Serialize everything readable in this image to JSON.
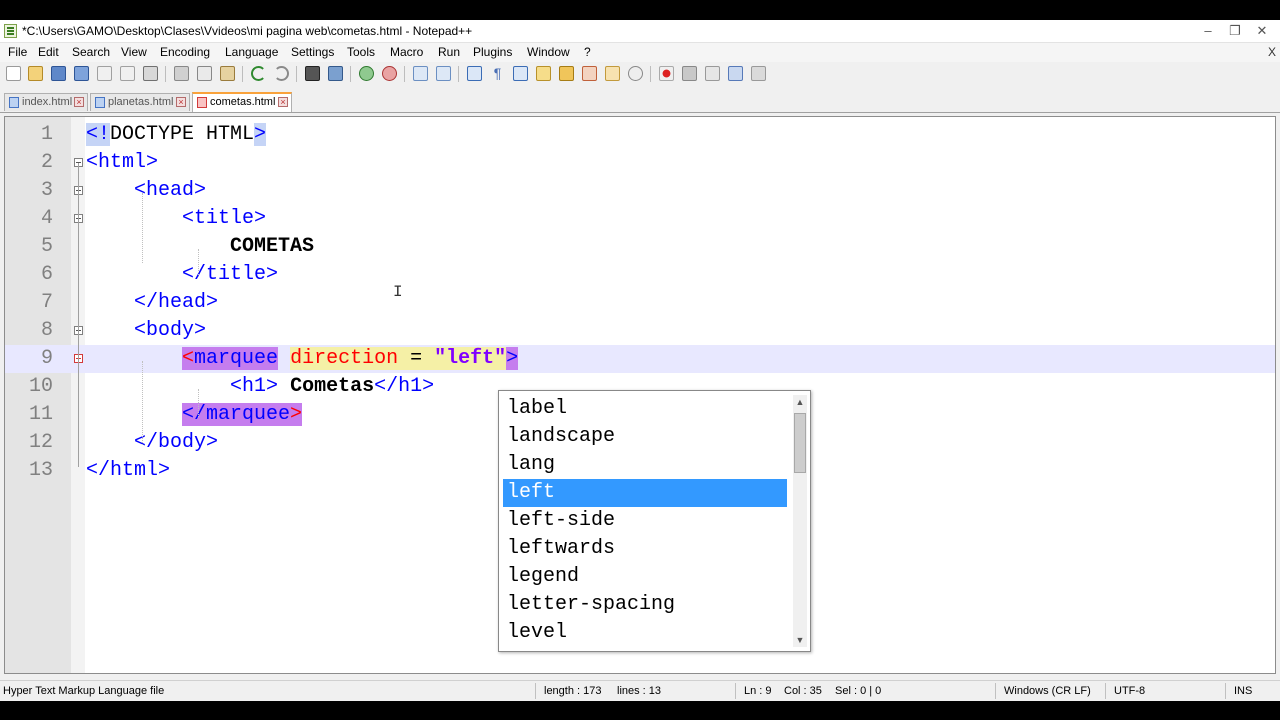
{
  "window": {
    "title": "*C:\\Users\\GAMO\\Desktop\\Clases\\Vvideos\\mi pagina web\\cometas.html - Notepad++",
    "controls": {
      "minimize": "–",
      "restore": "❐",
      "close": "✕"
    }
  },
  "menu": {
    "items": [
      "File",
      "Edit",
      "Search",
      "View",
      "Encoding",
      "Language",
      "Settings",
      "Tools",
      "Macro",
      "Run",
      "Plugins",
      "Window",
      "?"
    ],
    "close": "X"
  },
  "tabs": [
    {
      "label": "index.html",
      "active": false
    },
    {
      "label": "planetas.html",
      "active": false
    },
    {
      "label": "cometas.html",
      "active": true
    }
  ],
  "editor": {
    "current_line": 9,
    "lines": [
      {
        "num": "1",
        "frags": [
          [
            "<!",
            "hl-doc tag"
          ],
          [
            "DOCTYPE HTML",
            ""
          ],
          [
            ">",
            "hl-doc tag"
          ]
        ]
      },
      {
        "num": "2",
        "frags": [
          [
            "<html>",
            "tag"
          ]
        ]
      },
      {
        "num": "3",
        "frags": [
          [
            "    ",
            ""
          ],
          [
            "<head>",
            "tag"
          ]
        ]
      },
      {
        "num": "4",
        "frags": [
          [
            "        ",
            ""
          ],
          [
            "<title>",
            "tag"
          ]
        ]
      },
      {
        "num": "5",
        "frags": [
          [
            "            ",
            ""
          ],
          [
            "COMETAS",
            "bold"
          ]
        ]
      },
      {
        "num": "6",
        "frags": [
          [
            "        ",
            ""
          ],
          [
            "</title>",
            "tag"
          ]
        ]
      },
      {
        "num": "7",
        "frags": [
          [
            "    ",
            ""
          ],
          [
            "</head>",
            "tag"
          ]
        ]
      },
      {
        "num": "8",
        "frags": [
          [
            "    ",
            ""
          ],
          [
            "<body>",
            "tag"
          ]
        ]
      },
      {
        "num": "9",
        "frags": [
          [
            "        ",
            ""
          ],
          [
            "<",
            "hl-purple-red"
          ],
          [
            "marquee",
            "hl-purple tag"
          ],
          [
            " ",
            ""
          ],
          [
            "direction",
            "hl-yellow attr"
          ],
          [
            " = ",
            "hl-yellow"
          ],
          [
            "\"left\"",
            "hl-yellow str"
          ],
          [
            ">",
            "hl-purple tag"
          ]
        ]
      },
      {
        "num": "10",
        "frags": [
          [
            "            ",
            ""
          ],
          [
            "<h1>",
            "tag"
          ],
          [
            " ",
            ""
          ],
          [
            "Cometas",
            "bold"
          ],
          [
            "</h1>",
            "tag"
          ],
          [
            " ",
            ""
          ]
        ]
      },
      {
        "num": "11",
        "frags": [
          [
            "        ",
            ""
          ],
          [
            "</marquee",
            "hl-purple tag"
          ],
          [
            ">",
            "hl-purple-red"
          ]
        ]
      },
      {
        "num": "12",
        "frags": [
          [
            "    ",
            ""
          ],
          [
            "</body>",
            "tag"
          ]
        ]
      },
      {
        "num": "13",
        "frags": [
          [
            "</html>",
            "tag"
          ]
        ]
      }
    ]
  },
  "autocomplete": {
    "items": [
      "label",
      "landscape",
      "lang",
      "left",
      "left-side",
      "leftwards",
      "legend",
      "letter-spacing",
      "level"
    ],
    "selected": "left"
  },
  "status": {
    "filetype": "Hyper Text Markup Language file",
    "length": "length : 173",
    "lines": "lines : 13",
    "ln": "Ln : 9",
    "col": "Col : 35",
    "sel": "Sel : 0 | 0",
    "eol": "Windows (CR LF)",
    "encoding": "UTF-8",
    "mode": "INS"
  }
}
